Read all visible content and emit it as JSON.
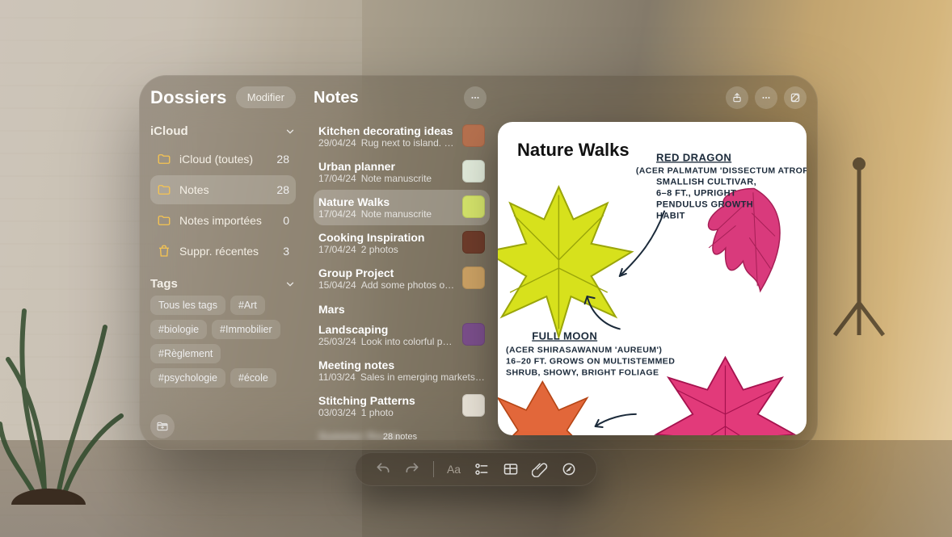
{
  "sidebar": {
    "title": "Dossiers",
    "edit_label": "Modifier",
    "sections": {
      "icloud": {
        "label": "iCloud",
        "items": [
          {
            "icon": "folder",
            "label": "iCloud (toutes)",
            "count": "28",
            "selected": false
          },
          {
            "icon": "folder",
            "label": "Notes",
            "count": "28",
            "selected": true
          },
          {
            "icon": "folder",
            "label": "Notes importées",
            "count": "0",
            "selected": false
          },
          {
            "icon": "trash",
            "label": "Suppr. récentes",
            "count": "3",
            "selected": false
          }
        ]
      },
      "tags": {
        "label": "Tags",
        "items": [
          "Tous les tags",
          "#Art",
          "#biologie",
          "#Immobilier",
          "#Règlement",
          "#psychologie",
          "#école"
        ]
      }
    },
    "new_folder_icon": "new-folder"
  },
  "notes_col": {
    "title": "Notes",
    "more_icon": "ellipsis",
    "groups": [
      {
        "label": null,
        "items": [
          {
            "title": "Kitchen decorating ideas",
            "date": "29/04/24",
            "preview": "Rug next to island. Cont…",
            "thumb": "#b5704e",
            "selected": false
          },
          {
            "title": "Urban planner",
            "date": "17/04/24",
            "preview": "Note manuscrite",
            "thumb": "#dfe8d8",
            "selected": false
          },
          {
            "title": "Nature Walks",
            "date": "17/04/24",
            "preview": "Note manuscrite",
            "thumb": "#d3e26a",
            "selected": true
          },
          {
            "title": "Cooking Inspiration",
            "date": "17/04/24",
            "preview": "2 photos",
            "thumb": "#6d3b2a",
            "selected": false
          },
          {
            "title": "Group Project",
            "date": "15/04/24",
            "preview": "Add some photos of the…",
            "thumb": "#caa063",
            "selected": false
          }
        ]
      },
      {
        "label": "Mars",
        "items": [
          {
            "title": "Landscaping",
            "date": "25/03/24",
            "preview": "Look into colorful peren…",
            "thumb": "#7a4e8a",
            "selected": false
          },
          {
            "title": "Meeting notes",
            "date": "11/03/24",
            "preview": "Sales in emerging markets are t…",
            "thumb": null,
            "selected": false
          },
          {
            "title": "Stitching Patterns",
            "date": "03/03/24",
            "preview": "1 photo",
            "thumb": "#e6e0d4",
            "selected": false
          },
          {
            "title": "Summer Recap",
            "date": "",
            "preview": "",
            "thumb": null,
            "selected": false,
            "blurred": true
          }
        ]
      }
    ],
    "footer_count": "28 notes"
  },
  "detail": {
    "actions": [
      "share",
      "more",
      "compose"
    ],
    "title": "Nature Walks",
    "annotations": {
      "red_dragon": {
        "heading": "RED DRAGON",
        "lines": [
          "(ACER PALMATUM 'DISSECTUM ATROPURPUREUM')",
          "SMALLISH CULTIVAR,",
          "6–8 FT., UPRIGHT",
          "PENDULUS GROWTH",
          "HABIT"
        ]
      },
      "full_moon": {
        "heading": "FULL MOON",
        "lines": [
          "(ACER SHIRASAWANUM 'AUREUM')",
          "16–20 FT. GROWS ON MULTISTEMMED",
          "SHRUB, SHOWY, BRIGHT FOLIAGE"
        ]
      }
    }
  },
  "toolbar": {
    "items": [
      {
        "name": "undo",
        "interact": false
      },
      {
        "name": "redo",
        "interact": false
      },
      {
        "name": "sep"
      },
      {
        "name": "text-format",
        "label": "Aa",
        "interact": true
      },
      {
        "name": "checklist",
        "interact": true
      },
      {
        "name": "table",
        "interact": true
      },
      {
        "name": "attach",
        "interact": true
      },
      {
        "name": "markup",
        "interact": true
      }
    ]
  }
}
